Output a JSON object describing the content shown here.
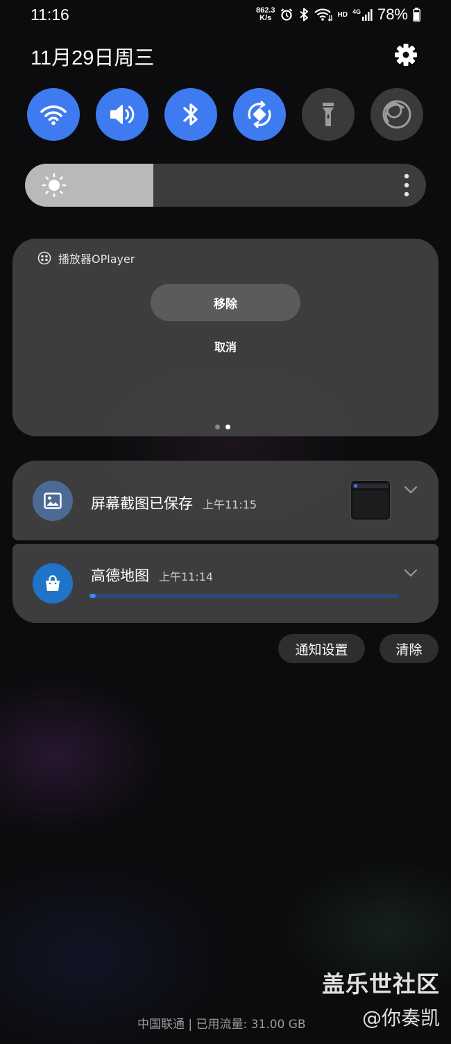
{
  "status_bar": {
    "time": "11:16",
    "net_speed_value": "862.3",
    "net_speed_unit": "K/s",
    "hd": "HD",
    "network": "4G",
    "battery": "78%"
  },
  "header": {
    "date": "11月29日周三"
  },
  "quick_settings": [
    {
      "name": "wifi-icon",
      "active": true
    },
    {
      "name": "sound-icon",
      "active": true
    },
    {
      "name": "bluetooth-icon",
      "active": true
    },
    {
      "name": "auto-rotate-icon",
      "active": true
    },
    {
      "name": "flashlight-icon",
      "active": false
    },
    {
      "name": "color-filter-icon",
      "active": false
    }
  ],
  "brightness": {
    "level": 0.32
  },
  "player_card": {
    "app_name": "播放器OPlayer",
    "remove_label": "移除",
    "cancel_label": "取消",
    "page_count": 2,
    "current_page": 2
  },
  "notifications": [
    {
      "app_icon": "image-icon",
      "title": "屏幕截图已保存",
      "time": "上午11:15",
      "icon_color": "#4d6a95"
    },
    {
      "app_icon": "shopping-bag-icon",
      "title": "高德地图",
      "time": "上午11:14",
      "icon_color": "#1f74c7",
      "progress": 0.02
    }
  ],
  "actions": {
    "notification_settings": "通知设置",
    "clear": "清除"
  },
  "footer": {
    "carrier_info": "中国联通 | 已用流量: 31.00 GB"
  },
  "watermark": {
    "line1": "盖乐世社区",
    "line2": "@你奏凯"
  },
  "colors": {
    "accent": "#3e7bf0",
    "card_bg": "#424244",
    "progress": "#3e86f5"
  }
}
